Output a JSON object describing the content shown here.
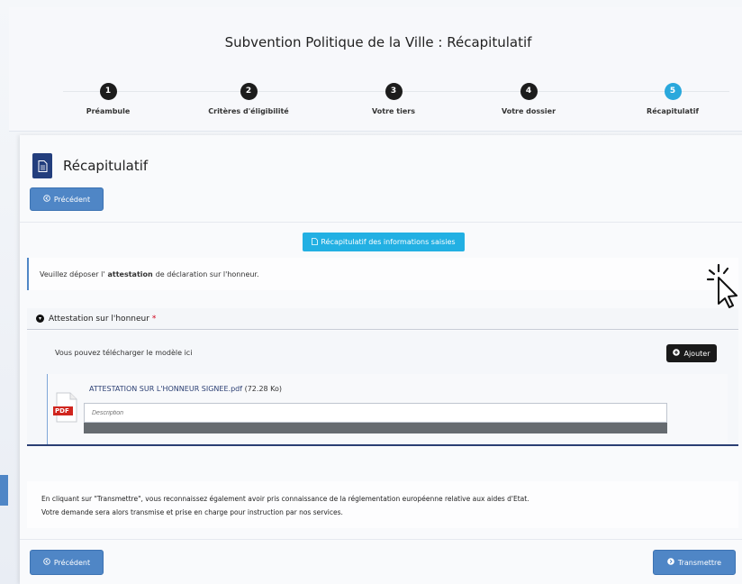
{
  "header": {
    "title": "Subvention Politique de la Ville : Récapitulatif"
  },
  "stepper": [
    {
      "num": "1",
      "label": "Préambule",
      "active": false
    },
    {
      "num": "2",
      "label": "Critères d'éligibilité",
      "active": false
    },
    {
      "num": "3",
      "label": "Votre tiers",
      "active": false
    },
    {
      "num": "4",
      "label": "Votre dossier",
      "active": false
    },
    {
      "num": "5",
      "label": "Récapitulatif",
      "active": true
    }
  ],
  "section": {
    "title": "Récapitulatif",
    "icon": "document-icon"
  },
  "buttons": {
    "previous_top": "Précédent",
    "recap": "Récapitulatif des informations saisies",
    "add": "Ajouter",
    "previous_bottom": "Précédent",
    "transmit": "Transmettre"
  },
  "info": {
    "prefix": "Veuillez déposer l'",
    "bold": "attestation",
    "suffix": "de déclaration sur l'honneur."
  },
  "attestation": {
    "heading": "Attestation sur l'honneur",
    "required_mark": "*",
    "download_text": "Vous pouvez télécharger le modèle ici",
    "file_name": "ATTESTATION SUR L'HONNEUR SIGNEE.pdf",
    "file_size": "(72.28 Ko)",
    "file_type_label": "PDF",
    "description_placeholder": "Description"
  },
  "legal": {
    "line1": "En cliquant sur \"Transmettre\", vous reconnaissez également avoir pris connaissance de la réglementation européenne relative aux aides d'Etat.",
    "line2": "Votre demande sera alors transmise et prise en charge pour instruction par nos services."
  },
  "colors": {
    "primary": "#4f86c6",
    "accent": "#22b0e3",
    "dark": "#1a1a1a",
    "navy": "#2b3f73",
    "required": "#d0021b"
  }
}
